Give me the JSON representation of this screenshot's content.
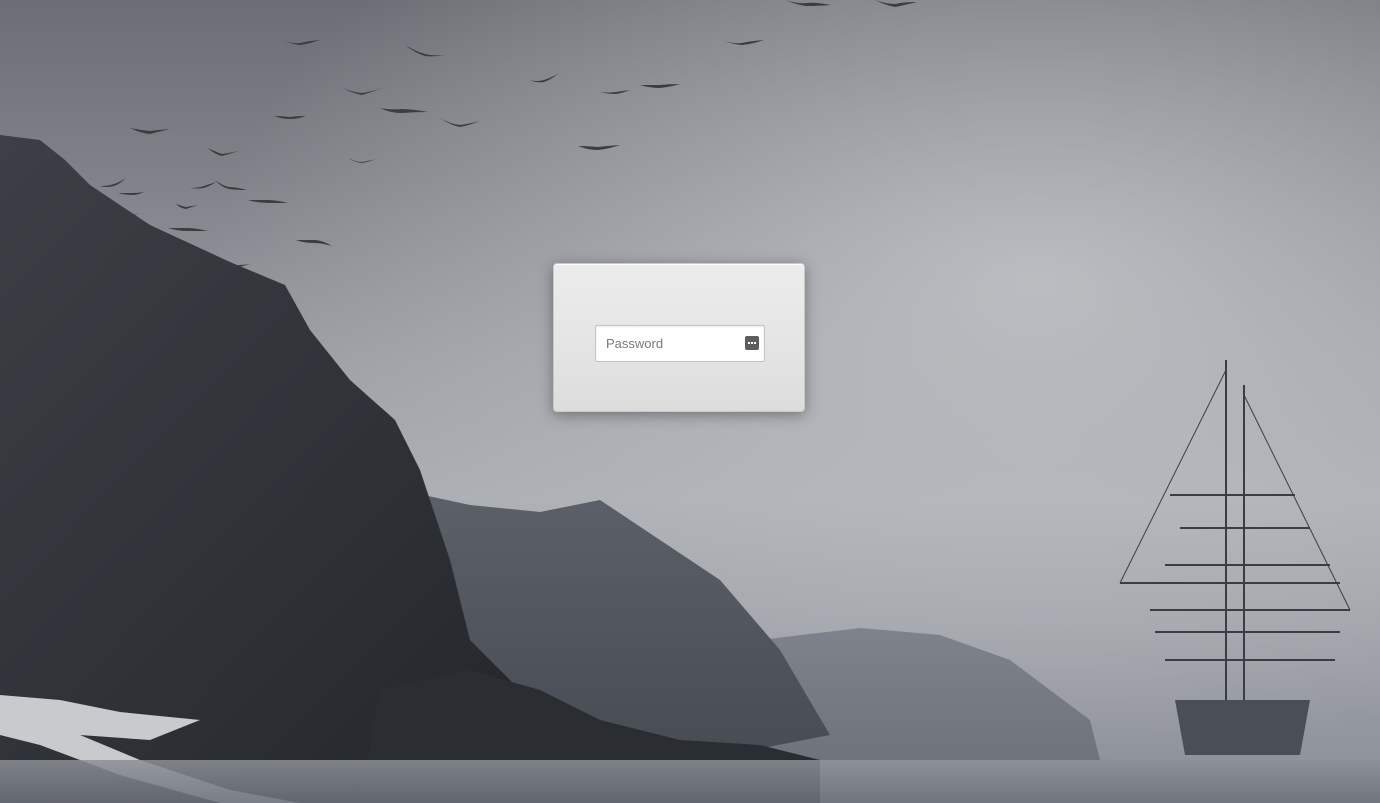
{
  "login": {
    "password_placeholder": "Password",
    "password_value": ""
  },
  "icons": {
    "password_manager": "password-dots-icon"
  },
  "colors": {
    "card_background": "#e6e6e6",
    "sky": "#8f9298",
    "icon": "#5d5d5d"
  }
}
